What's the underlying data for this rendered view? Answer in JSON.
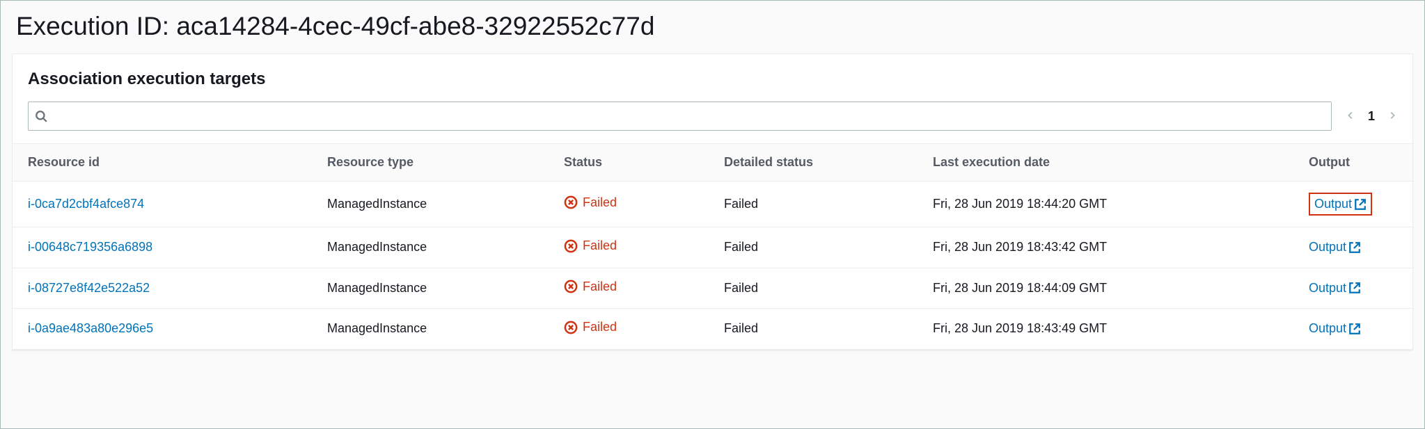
{
  "header": {
    "title": "Execution ID: aca14284-4cec-49cf-abe8-32922552c77d"
  },
  "panel": {
    "title": "Association execution targets",
    "search_placeholder": ""
  },
  "pager": {
    "current": "1"
  },
  "columns": {
    "resource_id": "Resource id",
    "resource_type": "Resource type",
    "status": "Status",
    "detailed_status": "Detailed status",
    "last_execution_date": "Last execution date",
    "output": "Output"
  },
  "status_labels": {
    "failed": "Failed"
  },
  "output_label": "Output",
  "rows": [
    {
      "resource_id": "i-0ca7d2cbf4afce874",
      "resource_type": "ManagedInstance",
      "status": "Failed",
      "detailed_status": "Failed",
      "last_execution_date": "Fri, 28 Jun 2019 18:44:20 GMT",
      "highlight_output": true
    },
    {
      "resource_id": "i-00648c719356a6898",
      "resource_type": "ManagedInstance",
      "status": "Failed",
      "detailed_status": "Failed",
      "last_execution_date": "Fri, 28 Jun 2019 18:43:42 GMT",
      "highlight_output": false
    },
    {
      "resource_id": "i-08727e8f42e522a52",
      "resource_type": "ManagedInstance",
      "status": "Failed",
      "detailed_status": "Failed",
      "last_execution_date": "Fri, 28 Jun 2019 18:44:09 GMT",
      "highlight_output": false
    },
    {
      "resource_id": "i-0a9ae483a80e296e5",
      "resource_type": "ManagedInstance",
      "status": "Failed",
      "detailed_status": "Failed",
      "last_execution_date": "Fri, 28 Jun 2019 18:43:49 GMT",
      "highlight_output": false
    }
  ]
}
